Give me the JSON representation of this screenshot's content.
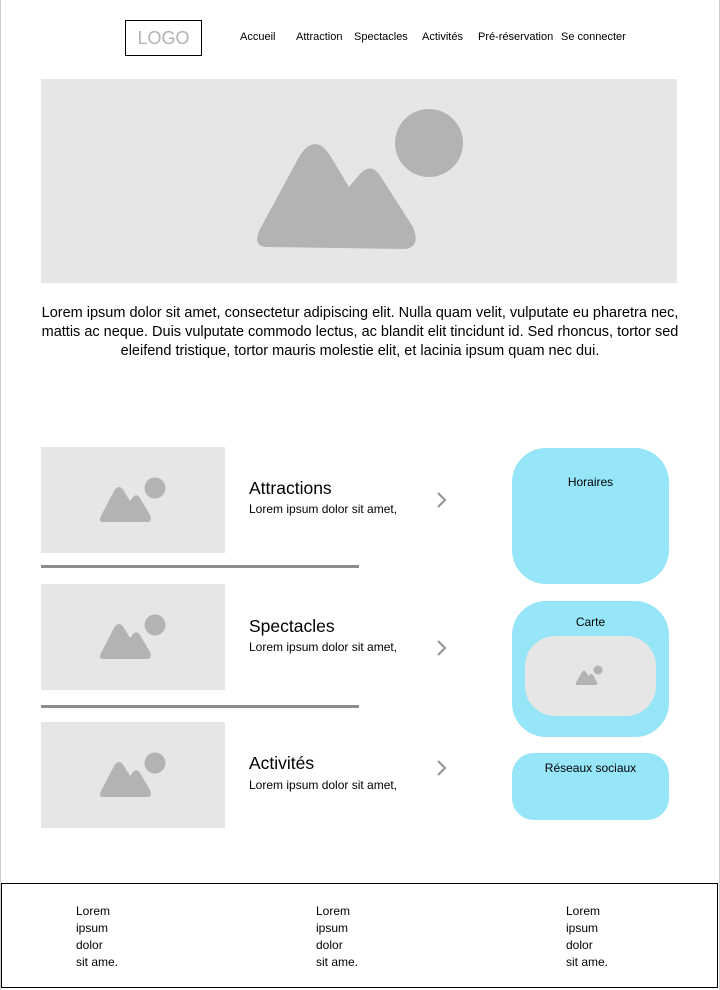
{
  "header": {
    "logo_text": "LOGO",
    "nav": [
      "Accueil",
      "Attraction",
      "Spectacles",
      "Activités",
      "Pré-réservation",
      "Se connecter"
    ]
  },
  "hero": {
    "image_icon": "image-placeholder-icon"
  },
  "intro": {
    "text": "Lorem ipsum dolor sit amet, consectetur adipiscing elit. Nulla quam velit, vulputate eu pharetra nec, mattis ac neque. Duis vulputate commodo lectus, ac blandit elit tincidunt id. Sed rhoncus, tortor sed eleifend tristique, tortor mauris molestie elit, et lacinia ipsum quam nec dui."
  },
  "sections": [
    {
      "title": "Attractions",
      "desc": "Lorem ipsum dolor sit amet,"
    },
    {
      "title": "Spectacles",
      "desc": "Lorem ipsum dolor sit amet,"
    },
    {
      "title": "Activités",
      "desc": "Lorem ipsum dolor sit amet,"
    }
  ],
  "sidebar": {
    "horaires": "Horaires",
    "carte": "Carte",
    "reseaux": "Réseaux sociaux"
  },
  "footer": {
    "columns": [
      [
        "Lorem",
        "ipsum",
        "dolor",
        "sit ame."
      ],
      [
        "Lorem",
        "ipsum",
        "dolor",
        "sit ame."
      ],
      [
        "Lorem",
        "ipsum",
        "dolor",
        "sit ame."
      ]
    ]
  },
  "colors": {
    "placeholder": "#e6e6e6",
    "icon": "#b3b3b3",
    "card": "#96e5f9",
    "divider": "#8c8c8c"
  }
}
